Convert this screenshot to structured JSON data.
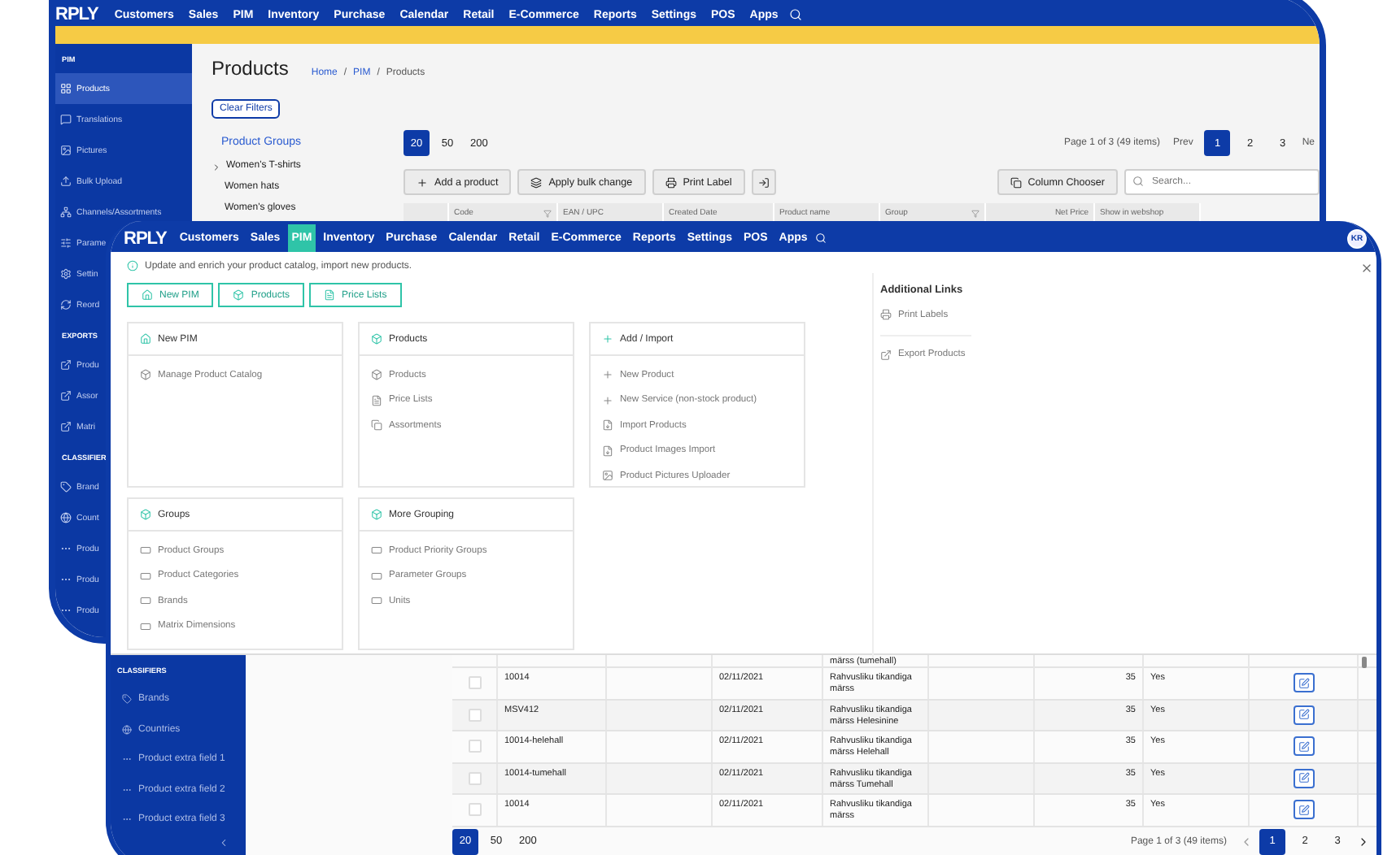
{
  "back_window": {
    "logo": "RPLY",
    "nav": [
      "Customers",
      "Sales",
      "PIM",
      "Inventory",
      "Purchase",
      "Calendar",
      "Retail",
      "E-Commerce",
      "Reports",
      "Settings",
      "POS",
      "Apps"
    ],
    "sidebar": [
      {
        "title": "PIM",
        "items": [
          {
            "label": "Products",
            "kind": "grid",
            "selected": true
          },
          {
            "label": "Translations",
            "kind": "chat",
            "selected": false
          },
          {
            "label": "Pictures",
            "kind": "picture",
            "selected": false
          },
          {
            "label": "Bulk Upload",
            "kind": "upload",
            "selected": false
          },
          {
            "label": "Channels/Assortments",
            "kind": "channel",
            "selected": false
          },
          {
            "label": "Parame",
            "kind": "sliders",
            "selected": false
          },
          {
            "label": "Settin",
            "kind": "gear",
            "selected": false
          },
          {
            "label": "Reord",
            "kind": "refresh",
            "selected": false
          }
        ]
      },
      {
        "title": "EXPORTS",
        "items": [
          {
            "label": "Produ",
            "kind": "export",
            "selected": false
          },
          {
            "label": "Assor",
            "kind": "export",
            "selected": false
          },
          {
            "label": "Matri",
            "kind": "export",
            "selected": false
          }
        ]
      },
      {
        "title": "CLASSIFIER",
        "items": [
          {
            "label": "Brand",
            "kind": "tag",
            "selected": false
          },
          {
            "label": "Count",
            "kind": "globe",
            "selected": false
          },
          {
            "label": "Produ",
            "kind": "dots",
            "selected": false
          },
          {
            "label": "Produ",
            "kind": "dots",
            "selected": false
          },
          {
            "label": "Produ",
            "kind": "dots",
            "selected": false
          }
        ]
      }
    ],
    "page_title": "Products",
    "breadcrumb": {
      "separator": "/",
      "items": [
        {
          "label": "Home",
          "link": true
        },
        {
          "label": "PIM",
          "link": true
        },
        {
          "label": "Products",
          "link": false
        }
      ]
    },
    "clear_filters": "Clear Filters",
    "product_groups": {
      "title": "Product Groups",
      "items": [
        {
          "label": "Women's T-shirts",
          "expandable": true
        },
        {
          "label": "Women hats",
          "expandable": false
        },
        {
          "label": "Women's gloves",
          "expandable": false
        }
      ]
    },
    "page_sizes": [
      {
        "label": "20",
        "selected": true
      },
      {
        "label": "50",
        "selected": false
      },
      {
        "label": "200",
        "selected": false
      }
    ],
    "pagination": {
      "summary": "Page 1 of 3 (49 items)",
      "prev": "Prev",
      "pages": [
        {
          "label": "1",
          "selected": true
        },
        {
          "label": "2",
          "selected": false
        },
        {
          "label": "3",
          "selected": false
        }
      ],
      "next": "Ne"
    },
    "toolbar": [
      {
        "kind": "add",
        "label": "Add a product"
      },
      {
        "kind": "bulk",
        "label": "Apply bulk change"
      },
      {
        "kind": "print",
        "label": "Print Label"
      },
      {
        "kind": "export"
      }
    ],
    "column_chooser": "Column Chooser",
    "search": {
      "placeholder": "Search..."
    },
    "columns": [
      {
        "label": "Code",
        "filter": true,
        "numeric": false
      },
      {
        "label": "EAN / UPC",
        "filter": false,
        "numeric": false
      },
      {
        "label": "Created Date",
        "filter": false,
        "numeric": false
      },
      {
        "label": "Product name",
        "filter": false,
        "numeric": false
      },
      {
        "label": "Group",
        "filter": true,
        "numeric": false
      },
      {
        "label": "Net Price",
        "filter": false,
        "numeric": true
      },
      {
        "label": "Show in webshop",
        "filter": false,
        "numeric": false
      }
    ]
  },
  "front_window": {
    "logo": "RPLY",
    "nav": [
      {
        "label": "Customers",
        "selected": false
      },
      {
        "label": "Sales",
        "selected": false
      },
      {
        "label": "PIM",
        "selected": true
      },
      {
        "label": "Inventory",
        "selected": false
      },
      {
        "label": "Purchase",
        "selected": false
      },
      {
        "label": "Calendar",
        "selected": false
      },
      {
        "label": "Retail",
        "selected": false
      },
      {
        "label": "E-Commerce",
        "selected": false
      },
      {
        "label": "Reports",
        "selected": false
      },
      {
        "label": "Settings",
        "selected": false
      },
      {
        "label": "POS",
        "selected": false
      },
      {
        "label": "Apps",
        "selected": false
      }
    ],
    "avatar": "KR",
    "pim_menu": {
      "info": "Update and enrich your product catalog, import new products.",
      "quick_buttons": [
        {
          "kind": "home",
          "label": "New PIM"
        },
        {
          "kind": "box",
          "label": "Products"
        },
        {
          "kind": "doc",
          "label": "Price Lists"
        }
      ],
      "cards": [
        {
          "kind": "home",
          "title": "New PIM",
          "links": [
            {
              "kind": "box",
              "label": "Manage Product Catalog"
            }
          ]
        },
        {
          "kind": "box",
          "title": "Products",
          "links": [
            {
              "kind": "box",
              "label": "Products"
            },
            {
              "kind": "doc",
              "label": "Price Lists"
            },
            {
              "kind": "copy",
              "label": "Assortments"
            }
          ]
        },
        {
          "kind": "plus",
          "title": "Add / Import",
          "links": [
            {
              "kind": "plus",
              "label": "New Product"
            },
            {
              "kind": "plus",
              "label": "New Service (non-stock product)"
            },
            {
              "kind": "file",
              "label": "Import Products"
            },
            {
              "kind": "file",
              "label": "Product Images Import"
            },
            {
              "kind": "image",
              "label": "Product Pictures Uploader"
            }
          ]
        },
        {
          "kind": "box",
          "title": "Groups",
          "links": [
            {
              "kind": "rect",
              "label": "Product Groups"
            },
            {
              "kind": "rect",
              "label": "Product Categories"
            },
            {
              "kind": "rect",
              "label": "Brands"
            },
            {
              "kind": "rect",
              "label": "Matrix Dimensions"
            }
          ]
        },
        {
          "kind": "box",
          "title": "More Grouping",
          "links": [
            {
              "kind": "rect",
              "label": "Product Priority Groups"
            },
            {
              "kind": "rect",
              "label": "Parameter Groups"
            },
            {
              "kind": "rect",
              "label": "Units"
            }
          ]
        }
      ],
      "additional_links": {
        "title": "Additional Links",
        "links": [
          {
            "kind": "print",
            "label": "Print Labels"
          },
          {
            "kind": "export",
            "label": "Export Products"
          }
        ]
      }
    },
    "sidebar": {
      "title": "CLASSIFIERS",
      "items": [
        {
          "label": "Brands",
          "kind": "tag"
        },
        {
          "label": "Countries",
          "kind": "globe"
        },
        {
          "label": "Product extra field 1",
          "kind": "dots"
        },
        {
          "label": "Product extra field 2",
          "kind": "dots"
        },
        {
          "label": "Product extra field 3",
          "kind": "dots"
        }
      ]
    },
    "partial_row_name": "märss (tumehall)",
    "rows": [
      {
        "code": "10014",
        "date": "02/11/2021",
        "name": "Rahvusliku tikandiga märss",
        "net_price": "35",
        "webshop": "Yes",
        "checked": false
      },
      {
        "code": "MSV412",
        "date": "02/11/2021",
        "name": "Rahvusliku tikandiga märss Helesinine",
        "net_price": "35",
        "webshop": "Yes",
        "checked": false
      },
      {
        "code": "10014-helehall",
        "date": "02/11/2021",
        "name": "Rahvusliku tikandiga märss Helehall",
        "net_price": "35",
        "webshop": "Yes",
        "checked": false
      },
      {
        "code": "10014-tumehall",
        "date": "02/11/2021",
        "name": "Rahvusliku tikandiga märss Tumehall",
        "net_price": "35",
        "webshop": "Yes",
        "checked": false
      },
      {
        "code": "10014",
        "date": "02/11/2021",
        "name": "Rahvusliku tikandiga märss",
        "net_price": "35",
        "webshop": "Yes",
        "checked": false
      }
    ],
    "page_sizes": [
      {
        "label": "20",
        "selected": true
      },
      {
        "label": "50",
        "selected": false
      },
      {
        "label": "200",
        "selected": false
      }
    ],
    "pagination": {
      "summary": "Page 1 of 3 (49 items)",
      "pages": [
        {
          "label": "1",
          "selected": true
        },
        {
          "label": "2",
          "selected": false
        },
        {
          "label": "3",
          "selected": false
        }
      ]
    }
  }
}
